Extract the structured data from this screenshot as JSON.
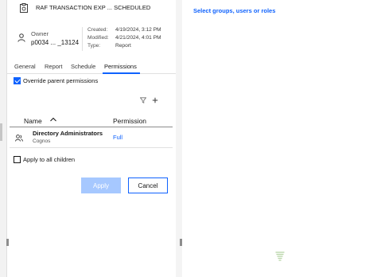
{
  "header": {
    "title": "RAF TRANSACTION EXP ... SCHEDULED"
  },
  "owner": {
    "label": "Owner",
    "value": "p0034 ... _13124"
  },
  "meta": [
    {
      "key": "Created:",
      "value": "4/19/2024, 3:12 PM"
    },
    {
      "key": "Modified:",
      "value": "4/21/2024, 4:01 PM"
    },
    {
      "key": "Type:",
      "value": "Report"
    }
  ],
  "tabs": [
    "General",
    "Report",
    "Schedule",
    "Permissions"
  ],
  "active_tab": "Permissions",
  "override": {
    "label": "Override parent permissions",
    "checked": true
  },
  "table": {
    "headers": {
      "name": "Name",
      "permission": "Permission"
    },
    "rows": [
      {
        "name": "Directory Administrators",
        "sub": "Cognos",
        "permission": "Full"
      }
    ]
  },
  "apply_all": {
    "label": "Apply to all children",
    "checked": false
  },
  "buttons": {
    "apply": "Apply",
    "cancel": "Cancel"
  },
  "right": {
    "title": "Select groups, users or roles"
  },
  "colors": {
    "accent": "#0f62fe",
    "apply_disabled": "#a6c8ff"
  }
}
